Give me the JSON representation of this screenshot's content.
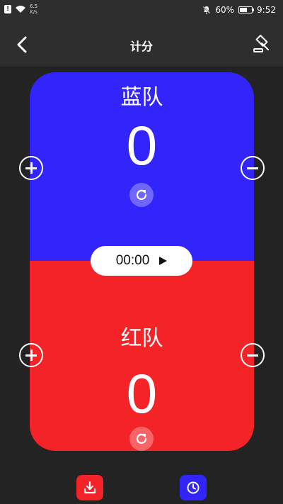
{
  "status_bar": {
    "alert_glyph": "!",
    "net_speed_value": "6.5",
    "net_speed_unit": "K/s",
    "battery_percent": "60%",
    "battery_level": 0.6,
    "time": "9:52"
  },
  "app_bar": {
    "title": "计分"
  },
  "blue_team": {
    "name": "蓝队",
    "score": "0",
    "color": "#3125fb"
  },
  "red_team": {
    "name": "红队",
    "score": "0",
    "color": "#f42327"
  },
  "timer": {
    "time": "00:00"
  },
  "icons": {
    "back": "chevron-left-icon",
    "referee": "gavel-icon",
    "download": "download-icon",
    "clock": "clock-icon",
    "reset": "refresh-icon",
    "add": "plus-icon",
    "subtract": "minus-icon",
    "play": "play-icon"
  },
  "bottom_bar": {
    "save_button_color": "#f42327",
    "history_button_color": "#3125fb"
  }
}
